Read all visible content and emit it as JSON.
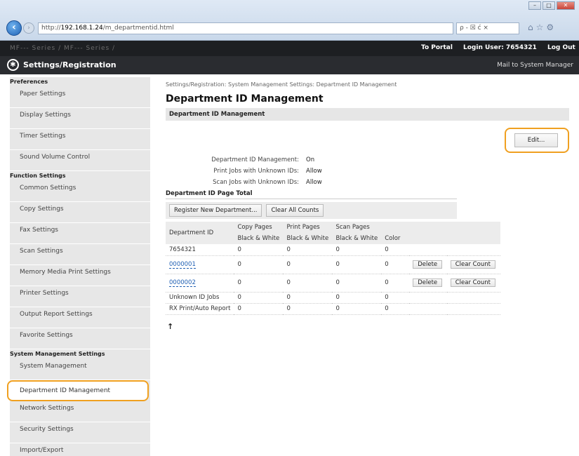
{
  "browser": {
    "url_prefix": "http://",
    "url_host": "192.168.1.24",
    "url_path": "/m_departmentid.html",
    "search_controls": "ρ - ☒ ć ×",
    "win_min": "–",
    "win_max": "□",
    "win_close": "✕"
  },
  "topbar": {
    "product": "MF--- Series / MF--- Series /",
    "to_portal": "To Portal",
    "login_user": "Login User:  7654321",
    "logout": "Log Out"
  },
  "header": {
    "title": "Settings/Registration",
    "mail": "Mail to System Manager"
  },
  "sidebar": {
    "preferences": "Preferences",
    "pref_items": [
      "Paper Settings",
      "Display Settings",
      "Timer Settings",
      "Sound Volume Control"
    ],
    "function": "Function Settings",
    "func_items": [
      "Common Settings",
      "Copy Settings",
      "Fax Settings",
      "Scan Settings",
      "Memory Media Print Settings",
      "Printer Settings",
      "Output Report Settings",
      "Favorite Settings"
    ],
    "system": "System Management Settings",
    "sys_items": [
      "System Management",
      "Department ID Management",
      "Network Settings",
      "Security Settings",
      "Import/Export"
    ]
  },
  "main": {
    "breadcrumb": "Settings/Registration: System Management Settings: Department ID Management",
    "title": "Department ID Management",
    "section": "Department ID Management",
    "edit_button": "Edit...",
    "info": [
      {
        "label": "Department ID Management:",
        "value": "On"
      },
      {
        "label": "Print Jobs with Unknown IDs:",
        "value": "Allow"
      },
      {
        "label": "Scan Jobs with Unknown IDs:",
        "value": "Allow"
      }
    ],
    "page_total_heading": "Department ID Page Total",
    "register_button": "Register New Department...",
    "clear_all_button": "Clear All Counts",
    "table": {
      "header_dept": "Department ID",
      "header_copy": "Copy Pages",
      "header_print": "Print Pages",
      "header_scan": "Scan Pages",
      "bw": "Black & White",
      "color": "Color",
      "rows": [
        {
          "id": "7654321",
          "copy": "0",
          "print": "0",
          "scan_bw": "0",
          "scan_color": "0"
        },
        {
          "id": "0000001",
          "copy": "0",
          "print": "0",
          "scan_bw": "0",
          "scan_color": "0"
        },
        {
          "id": "0000002",
          "copy": "0",
          "print": "0",
          "scan_bw": "0",
          "scan_color": "0"
        },
        {
          "id": "Unknown ID Jobs",
          "copy": "0",
          "print": "0",
          "scan_bw": "0",
          "scan_color": "0"
        },
        {
          "id": "RX Print/Auto Report",
          "copy": "0",
          "print": "0",
          "scan_bw": "0",
          "scan_color": "0"
        }
      ],
      "delete_label": "Delete",
      "clear_count_label": "Clear Count"
    },
    "to_top": "↑"
  }
}
